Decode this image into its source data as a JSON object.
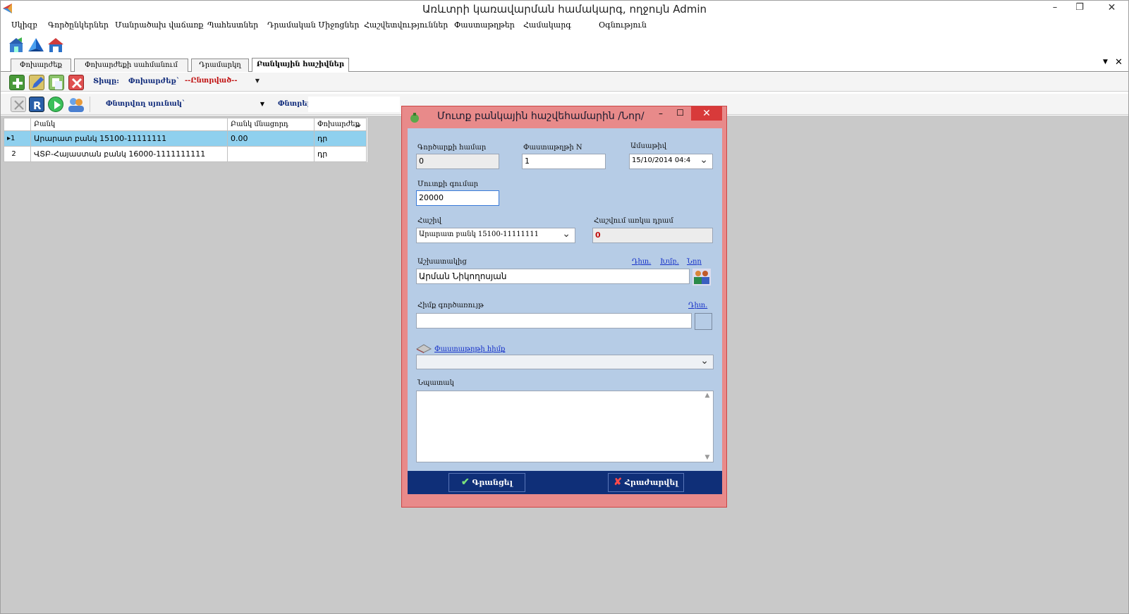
{
  "window": {
    "title": "Առևտրի կառավարման համակարգ, ողջույն Admin",
    "minimize": "–",
    "restore": "❐",
    "close": "✕"
  },
  "menu": [
    "Սկիզբ",
    "Գործընկերներ",
    "Մանրածախ վաճառք",
    "Պահեստներ",
    "Դրամական Միջոցներ",
    "Հաշվետվություններ",
    "Փաստաթղթեր",
    "Համակարգ",
    "Օգնություն"
  ],
  "tabs": [
    "Փոխարժեք",
    "Փոխարժեքի սահմանում",
    "Դրամարկղ",
    "Բանկային հաշիվներ"
  ],
  "tabstrip_controls": {
    "dropdown": "▼",
    "close": "✕"
  },
  "toolbar1": {
    "type_label": "Տիպը:",
    "type_value": "Փոխարժեք`",
    "selected": "--Ընտրված--"
  },
  "toolbar2": {
    "search_column": "Փնտրվող սյունակ`",
    "search_label": "Փնտրել`"
  },
  "grid": {
    "columns": [
      "Բանկ",
      "Բանկ մնացորդ",
      "Փոխարժեք"
    ],
    "rows": [
      {
        "num": "1",
        "bank": "Արարատ բանկ 15100-11111111",
        "balance": "0.00",
        "currency": "դր"
      },
      {
        "num": "2",
        "bank": "ՎՏԲ-Հայաստան բանկ 16000-1111111111",
        "balance": "",
        "currency": "դր"
      }
    ]
  },
  "dialog": {
    "title": "Մուտք բանկային հաշվեհամարին /Նոր/",
    "minimize": "–",
    "maximize": "☐",
    "close": "✕",
    "doc_number_label": "Գործարքի համար",
    "doc_number": "0",
    "invoice_label": "Փաստաթղթի N",
    "invoice": "1",
    "date_label": "Ամսաթիվ",
    "date": "15/10/2014 04:4",
    "amount_label": "Մուտքի գումար",
    "amount": "20000",
    "account_label": "Հաշիվ",
    "account": "Արարատ բանկ 15100-11111111",
    "balance_label": "Հաշվում առկա դրամ",
    "balance": "0",
    "employee_label": "Աշխատակից",
    "employee": "Արման Նիկողոսյան",
    "employee_links": {
      "view": "Դիտ.",
      "edit": "Խմբ.",
      "new": "Նոր"
    },
    "fund_label": "Հիմք գործառույթ",
    "fund_link": "Դիտ.",
    "fund": "",
    "doc_basis_label": "Փաստաթղթի հիմք",
    "doc_basis": "",
    "note_label": "Նպատակ",
    "note": "",
    "save": "Գրանցել",
    "cancel": "Հրաժարվել"
  },
  "colors": {
    "dialog_frame": "#e88a8a",
    "dialog_body": "#b6cce6",
    "dialog_footer": "#0f2f78",
    "selected_row": "#8fd0ee"
  }
}
